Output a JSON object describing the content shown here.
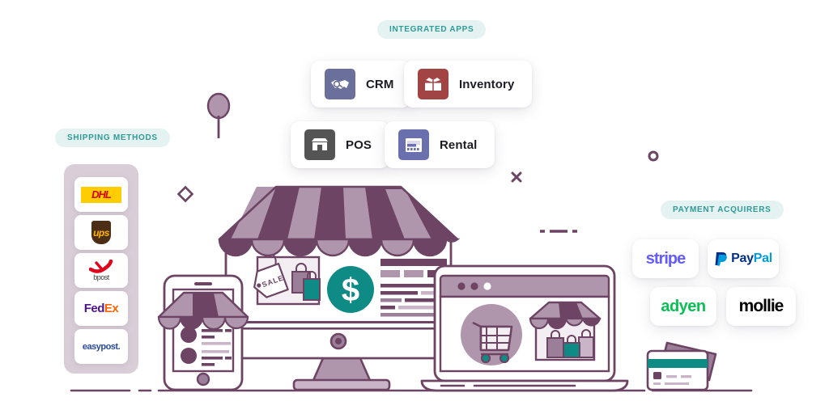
{
  "page": {
    "title": "Ecommerce integrations illustration",
    "background": "#ffffff"
  },
  "badges": {
    "integrated_apps": "INTEGRATED APPS",
    "shipping_methods": "SHIPPING METHODS",
    "payment_acquirers": "PAYMENT ACQUIRERS",
    "badge_bg": "#e4f3f1",
    "badge_text_color": "#2f9a97"
  },
  "apps": [
    {
      "label": "CRM",
      "icon": "handshake-icon",
      "icon_bg": "#6a6f9c"
    },
    {
      "label": "Inventory",
      "icon": "open-box-icon",
      "icon_bg": "#a34444"
    },
    {
      "label": "POS",
      "icon": "storefront-icon",
      "icon_bg": "#545454"
    },
    {
      "label": "Rental",
      "icon": "calendar-icon",
      "icon_bg": "#6a6fae"
    }
  ],
  "shipping_methods": [
    {
      "name": "DHL",
      "wordmark": "DHL",
      "color": "#d40511",
      "bg": "#ffcc00"
    },
    {
      "name": "UPS",
      "wordmark": "ups",
      "color": "#ffb500",
      "bg": "#4b2e15"
    },
    {
      "name": "bpost",
      "wordmark": "bpost",
      "color": "#e2001a",
      "bg": "#ffffff"
    },
    {
      "name": "FedEx",
      "wordmark": "FedEx",
      "color": "#4d148c",
      "bg": "#ffffff"
    },
    {
      "name": "easypost",
      "wordmark": "easypost.",
      "color": "#2b4a9b",
      "bg": "#ffffff"
    }
  ],
  "payment_acquirers": [
    {
      "name": "stripe",
      "wordmark": "stripe",
      "color": "#635bff"
    },
    {
      "name": "PayPal",
      "wordmark": "PayPal",
      "color": "#003087",
      "accent": "#009cde"
    },
    {
      "name": "adyen",
      "wordmark": "adyen",
      "color": "#0abf53"
    },
    {
      "name": "mollie",
      "wordmark": "mollie",
      "color": "#000000"
    }
  ],
  "illustration": {
    "storefront": {
      "awning_dark": "#6d4464",
      "awning_light": "#b096ad",
      "sale_tag_text": "SALE",
      "currency_symbol": "$",
      "currency_badge_color": "#0f8b85"
    },
    "devices": [
      "phone",
      "desktop-monitor",
      "laptop",
      "credit-cards"
    ],
    "palette": {
      "outline": "#6d4464",
      "mid_purple": "#9b7e98",
      "light_purple": "#c9b5c7",
      "pale": "#f2eef2",
      "teal": "#0f8b85"
    },
    "decorations": [
      "balloon-pin",
      "diamond-outline",
      "x-mark",
      "ring-outline",
      "dashed-line"
    ]
  }
}
